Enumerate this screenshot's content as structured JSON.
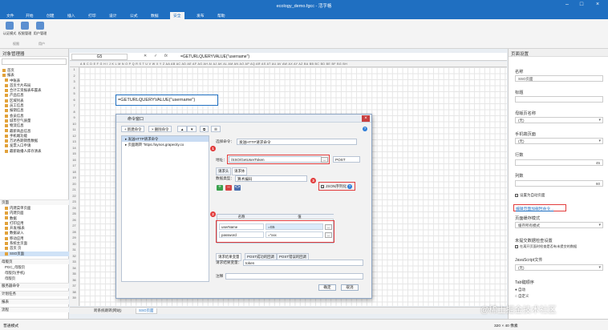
{
  "window": {
    "title": "ecology_demo.fgcc - 活字格"
  },
  "ribbon": {
    "tabs": [
      "文件",
      "开始",
      "创建",
      "插入",
      "打印",
      "设计",
      "公式",
      "数据",
      "安全",
      "发布",
      "帮助"
    ],
    "active_tab": "安全",
    "buttons": [
      "认证模式",
      "权限管理",
      "用户管理"
    ],
    "group_labels": [
      "权限",
      "用户"
    ]
  },
  "left_pane": {
    "title": "对象管理器",
    "tree_items": [
      "首页",
      "报表",
      "中账表",
      "首页卡片布局",
      "合计工资报表布置表",
      "产品信息",
      "区域列表",
      "员工信息",
      "报销信息",
      "会员信息",
      "城市空气质量",
      "物流信息",
      "最新商品信息",
      "手机端功能",
      "万达各期销售数据",
      "发票入口申请",
      "最新助播人库存清表"
    ],
    "selected_item": "SSO页面",
    "page_section_label": "页面",
    "page_items": [
      "内建菜单页面",
      "内建页面",
      "数据",
      "打印应用",
      "开发/报表",
      "数据录入",
      "移动应用",
      "系统主页面",
      "首页 页",
      "SSO页面"
    ],
    "sections": [
      "母版页",
      "PGC_母版页",
      "母版页(手机)",
      "母版页",
      "服务器命令",
      "计划任务",
      "报表",
      "流程"
    ]
  },
  "formula_bar": {
    "cell_ref": "G5",
    "formula": "=GETURLQUERYVALUE(\"username\")"
  },
  "sheet": {
    "column_letters": "A B C D E F G H I J K L M N O P Q R S T U V W X Y Z AA AB AC AD AE AF AG AH AI AJ AK AL AM AN AO AP AQ AR AS AT AU AV AW AX AY AZ BA BB BC BD BE BF BG BH",
    "rows": [
      "1",
      "2",
      "3",
      "4",
      "5",
      "6",
      "7",
      "8",
      "9",
      "10",
      "11",
      "12",
      "13",
      "14",
      "15",
      "16",
      "17",
      "18",
      "19",
      "20",
      "21",
      "22",
      "23",
      "24",
      "25",
      "26",
      "27",
      "28",
      "29",
      "30",
      "31",
      "32",
      "33",
      "34",
      "35",
      "36",
      "37",
      "38",
      "39"
    ],
    "cell_text": "=GETURLQUERYVALUE(\"username\")",
    "sheet_tabs": [
      "跨系统跳转(网站)",
      "SSO页面"
    ],
    "active_sheet_tab": "SSO页面"
  },
  "dialog": {
    "title": "命令窗口",
    "toolbar": [
      "新建命令",
      "删除命令"
    ],
    "commands": [
      "发送HTTP请求命令",
      "页面跳转 \"https://aynos.grapecity.co"
    ],
    "labels": {
      "select_command": "选择命令：",
      "address": "地址：",
      "data_type": "数据类型：",
      "name_col": "名称",
      "value_col": "值",
      "result_var": "请求结果变量：",
      "note": "注释"
    },
    "command_value": "发送HTTP请求命令",
    "address_value": "/SSO/GetUserToken",
    "method": "POST",
    "tabs": [
      "请求头",
      "请求体"
    ],
    "data_type_value": "算术编码",
    "json_label": "JSON序列化",
    "params": [
      {
        "name": "userName",
        "value": "=G5"
      },
      {
        "name": "password",
        "value": "=\"xxx"
      }
    ],
    "bottom_tabs": [
      "请求结果变量",
      "POST成功的回调",
      "POST错误的回调"
    ],
    "result_var_value": "token",
    "ok": "确定",
    "cancel": "取消",
    "badges": [
      "1",
      "2",
      "3"
    ]
  },
  "right_pane": {
    "title": "页面设置",
    "name_label": "名称",
    "name_value": "SSO页面",
    "title_label": "标题",
    "master_label": "母版页名称",
    "master_value": "(无)",
    "mobile_label": "手机端页面",
    "mobile_value": "(无)",
    "rows_label": "行数",
    "rows_value": "45",
    "cols_label": "列数",
    "cols_value": "60",
    "adaptive_label": "设置为自动页面",
    "link": "编辑页面加载时命令...",
    "cache_label": "页面缓存模式",
    "cache_value": "缓存所有模式",
    "unsaved_label": "未提交数据检查设置",
    "unsaved_option": "在离开页面时检查是否有未提交的数据",
    "js_label": "JavaScript文件",
    "js_value": "(无)",
    "tab_label": "Tab键顺序",
    "tab_opts": [
      "自动",
      "自定义"
    ]
  },
  "status_bar": {
    "mode": "普通模式",
    "zoom": "320 × 40 像素"
  },
  "watermark": "@稀土掘金技术社区",
  "colors": {
    "titlebar": "#1f6fc1",
    "highlight": "#e23c3c",
    "accent": "#2f7ed8"
  }
}
